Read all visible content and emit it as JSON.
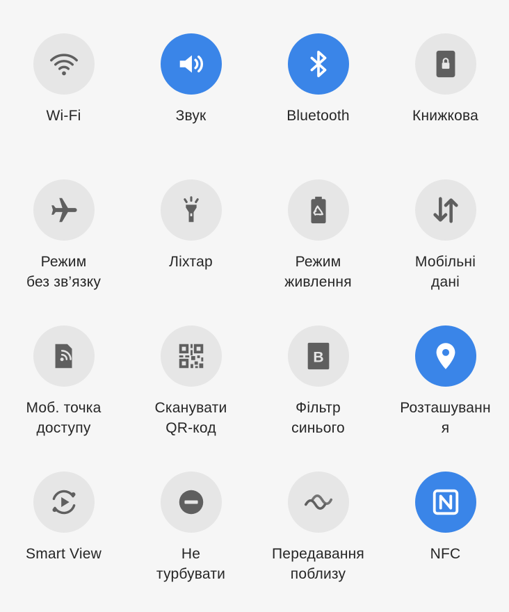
{
  "tiles": [
    {
      "label": "Wi-Fi",
      "icon": "wifi-icon",
      "active": false
    },
    {
      "label": "Звук",
      "icon": "sound-icon",
      "active": true
    },
    {
      "label": "Bluetooth",
      "icon": "bluetooth-icon",
      "active": true
    },
    {
      "label": "Книжкова",
      "icon": "portrait-lock-icon",
      "active": false
    },
    {
      "label": "Режим\nбез зв’язку",
      "icon": "airplane-icon",
      "active": false
    },
    {
      "label": "Ліхтар",
      "icon": "flashlight-icon",
      "active": false
    },
    {
      "label": "Режим\nживлення",
      "icon": "battery-saver-icon",
      "active": false
    },
    {
      "label": "Мобільні\nдані",
      "icon": "mobile-data-icon",
      "active": false
    },
    {
      "label": "Моб. точка\nдоступу",
      "icon": "hotspot-icon",
      "active": false
    },
    {
      "label": "Сканувати\nQR-код",
      "icon": "qr-code-icon",
      "active": false
    },
    {
      "label": "Фільтр\nсинього",
      "icon": "blue-light-filter-icon",
      "active": false
    },
    {
      "label": "Розташуванн\nя",
      "icon": "location-icon",
      "active": true
    },
    {
      "label": "Smart View",
      "icon": "smart-view-icon",
      "active": false
    },
    {
      "label": "Не\nтурбувати",
      "icon": "do-not-disturb-icon",
      "active": false
    },
    {
      "label": "Передавання\nпоблизу",
      "icon": "nearby-share-icon",
      "active": false
    },
    {
      "label": "NFC",
      "icon": "nfc-icon",
      "active": true
    }
  ],
  "colors": {
    "active": "#3a85e8",
    "inactive": "#e6e6e6",
    "icon_inactive": "#5f5f5f",
    "icon_active": "#ffffff",
    "background": "#f6f6f6",
    "text": "#262626"
  }
}
